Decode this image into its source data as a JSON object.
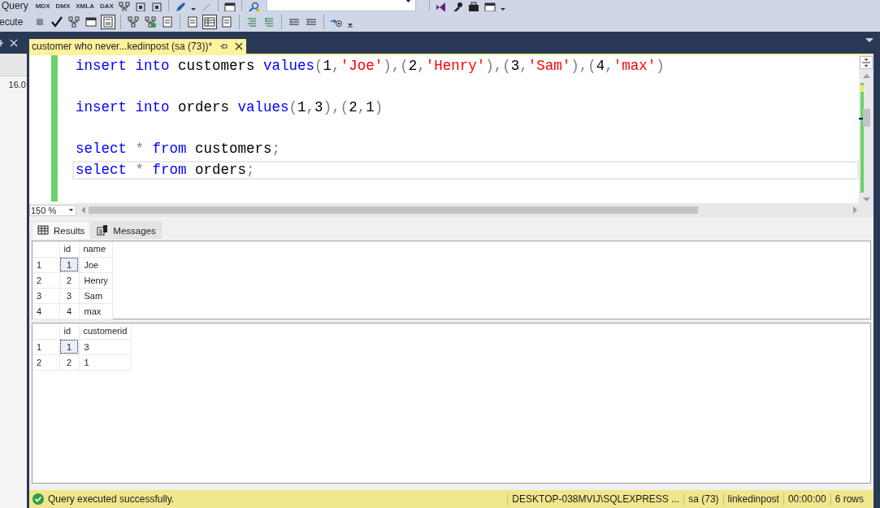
{
  "toolbar": {
    "row1_label": "Query",
    "language_buttons": [
      "MDX",
      "DMX",
      "XMLA",
      "DAX"
    ],
    "row2_label": "ecute"
  },
  "object_explorer": {
    "item": "16.0"
  },
  "document_tab": {
    "title": "customer who never...kedinpost (sa (73))*",
    "selected": true
  },
  "editor": {
    "lines": [
      {
        "kind": "code",
        "current": false,
        "tokens": [
          {
            "kind": "keyword",
            "text": "insert "
          },
          {
            "kind": "keyword",
            "text": "into"
          },
          {
            "kind": "plain",
            "text": " customers "
          },
          {
            "kind": "keyword",
            "text": "values"
          },
          {
            "kind": "operator",
            "text": "("
          },
          {
            "kind": "plain",
            "text": "1"
          },
          {
            "kind": "operator",
            "text": ","
          },
          {
            "kind": "string",
            "text": "'Joe'"
          },
          {
            "kind": "operator",
            "text": "),("
          },
          {
            "kind": "plain",
            "text": "2"
          },
          {
            "kind": "operator",
            "text": ","
          },
          {
            "kind": "string",
            "text": "'Henry'"
          },
          {
            "kind": "operator",
            "text": "),("
          },
          {
            "kind": "plain",
            "text": "3"
          },
          {
            "kind": "operator",
            "text": ","
          },
          {
            "kind": "string",
            "text": "'Sam'"
          },
          {
            "kind": "operator",
            "text": "),("
          },
          {
            "kind": "plain",
            "text": "4"
          },
          {
            "kind": "operator",
            "text": ","
          },
          {
            "kind": "string",
            "text": "'max'"
          },
          {
            "kind": "operator",
            "text": ")"
          }
        ]
      },
      {
        "kind": "blank"
      },
      {
        "kind": "code",
        "current": false,
        "tokens": [
          {
            "kind": "keyword",
            "text": "insert "
          },
          {
            "kind": "keyword",
            "text": "into"
          },
          {
            "kind": "plain",
            "text": " orders "
          },
          {
            "kind": "keyword",
            "text": "values"
          },
          {
            "kind": "operator",
            "text": "("
          },
          {
            "kind": "plain",
            "text": "1"
          },
          {
            "kind": "operator",
            "text": ","
          },
          {
            "kind": "plain",
            "text": "3"
          },
          {
            "kind": "operator",
            "text": "),("
          },
          {
            "kind": "plain",
            "text": "2"
          },
          {
            "kind": "operator",
            "text": ","
          },
          {
            "kind": "plain",
            "text": "1"
          },
          {
            "kind": "operator",
            "text": ")"
          }
        ]
      },
      {
        "kind": "blank"
      },
      {
        "kind": "code",
        "current": false,
        "tokens": [
          {
            "kind": "keyword",
            "text": "select "
          },
          {
            "kind": "operator",
            "text": "* "
          },
          {
            "kind": "keyword",
            "text": "from"
          },
          {
            "kind": "plain",
            "text": " customers"
          },
          {
            "kind": "operator",
            "text": ";"
          }
        ]
      },
      {
        "kind": "code",
        "current": true,
        "tokens": [
          {
            "kind": "keyword",
            "text": "select "
          },
          {
            "kind": "operator",
            "text": "* "
          },
          {
            "kind": "keyword",
            "text": "from"
          },
          {
            "kind": "plain",
            "text": " orders"
          },
          {
            "kind": "operator",
            "text": ";"
          }
        ]
      }
    ]
  },
  "zoom": {
    "value": "150 %"
  },
  "result_tabs": [
    {
      "label": "Results",
      "selected": true
    },
    {
      "label": "Messages",
      "selected": false
    }
  ],
  "grids": [
    {
      "columns": [
        "id",
        "name"
      ],
      "rows": [
        {
          "number": "1",
          "cells": [
            "1",
            "Joe"
          ],
          "focused": true
        },
        {
          "number": "2",
          "cells": [
            "2",
            "Henry"
          ],
          "focused": false
        },
        {
          "number": "3",
          "cells": [
            "3",
            "Sam"
          ],
          "focused": false
        },
        {
          "number": "4",
          "cells": [
            "4",
            "max"
          ],
          "focused": false
        }
      ]
    },
    {
      "columns": [
        "id",
        "customerid"
      ],
      "rows": [
        {
          "number": "1",
          "cells": [
            "1",
            "3"
          ],
          "focused": true
        },
        {
          "number": "2",
          "cells": [
            "2",
            "1"
          ],
          "focused": false
        }
      ]
    }
  ],
  "status_bar": {
    "message": "Query executed successfully.",
    "server": "DESKTOP-038MVIJ\\SQLEXPRESS ...",
    "user": "sa (73)",
    "database": "linkedinpost",
    "elapsed": "00:00:00",
    "rows": "6 rows"
  }
}
